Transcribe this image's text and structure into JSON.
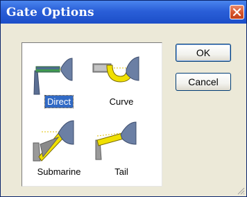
{
  "window": {
    "title": "Gate Options"
  },
  "gates": [
    {
      "id": "direct",
      "label": "Direct",
      "selected": true
    },
    {
      "id": "curve",
      "label": "Curve",
      "selected": false
    },
    {
      "id": "submarine",
      "label": "Submarine",
      "selected": false
    },
    {
      "id": "tail",
      "label": "Tail",
      "selected": false
    }
  ],
  "buttons": {
    "ok": "OK",
    "cancel": "Cancel"
  },
  "colors": {
    "titlebar": "#2a5fd8",
    "close": "#d6542c",
    "gate_fill": "#f0e000",
    "runner": "#808080",
    "part": "#5b6f93",
    "selection": "#316ac5"
  }
}
